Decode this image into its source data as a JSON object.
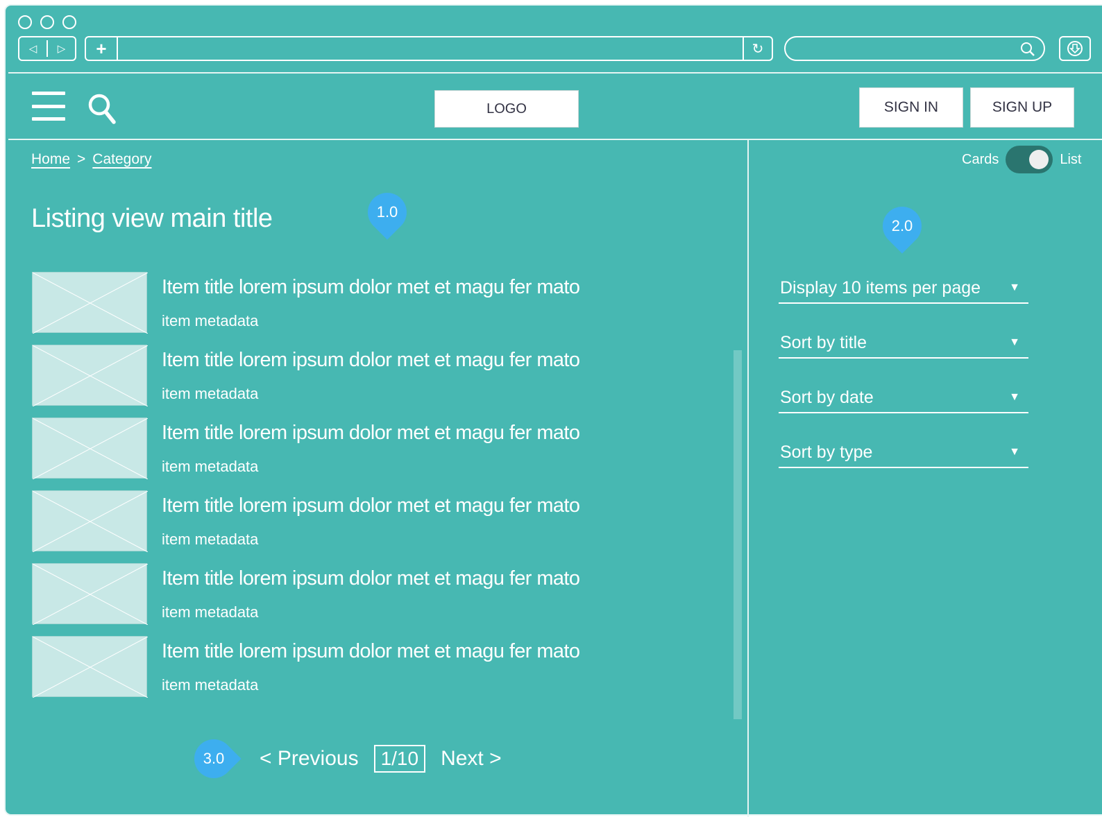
{
  "chrome": {
    "back_glyph": "◁",
    "forward_glyph": "▷",
    "new_tab_glyph": "+",
    "reload_glyph": "↻"
  },
  "header": {
    "logo": "LOGO",
    "sign_in": "SIGN IN",
    "sign_up": "SIGN UP"
  },
  "breadcrumb": {
    "home": "Home",
    "separator": ">",
    "category": "Category"
  },
  "main": {
    "title": "Listing view main title",
    "items": [
      {
        "title": "Item title lorem ipsum dolor met et magu fer mato",
        "meta": "item metadata"
      },
      {
        "title": "Item title lorem ipsum dolor met et magu fer mato",
        "meta": "item metadata"
      },
      {
        "title": "Item title lorem ipsum dolor met et magu fer mato",
        "meta": "item metadata"
      },
      {
        "title": "Item title lorem ipsum dolor met et magu fer mato",
        "meta": "item metadata"
      },
      {
        "title": "Item title lorem ipsum dolor met et magu fer mato",
        "meta": "item metadata"
      },
      {
        "title": "Item title lorem ipsum dolor met et magu fer mato",
        "meta": "item metadata"
      }
    ]
  },
  "pagination": {
    "previous": "< Previous",
    "page": "1/10",
    "next": "Next >"
  },
  "sidebar": {
    "toggle_left": "Cards",
    "toggle_right": "List",
    "display_select": "Display 10 items per page",
    "sort_title": "Sort by title",
    "sort_date": "Sort by date",
    "sort_type": "Sort by type",
    "arrow_glyph": "▼"
  },
  "markers": {
    "m1": "1.0",
    "m2": "2.0",
    "m3": "3.0"
  },
  "colors": {
    "background": "#47b8b2",
    "marker": "#3daeef",
    "toggle_track": "#2a756f",
    "thumbnail": "#c8e8e6"
  }
}
